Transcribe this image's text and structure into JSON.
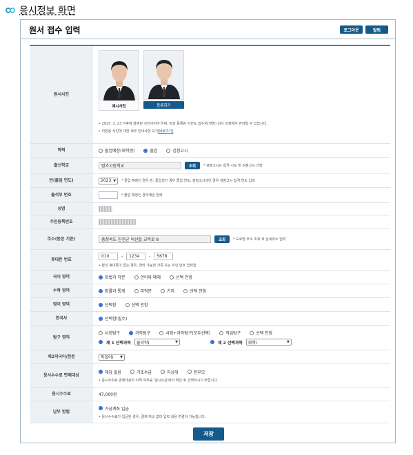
{
  "page_heading": "응시정보 화면",
  "form": {
    "title": "원서 접수 입력",
    "logout_label": "로그아웃",
    "withdraw_label": "탈퇴",
    "save_label": "저장"
  },
  "photo": {
    "label": "원서사진",
    "sample_caption": "예시사진",
    "register_label": "등록하기",
    "note1": "• 2025. 2. 23 이후에 촬영된 사진이어야 하며, 정상 등록된 사진도 접수처(현장) 심사 과정에서 반려될 수 있습니다.",
    "note2_prefix": "• 여권용 사진에 대한 세부 안내사항 보기",
    "note2_link": "[바로가기]"
  },
  "education": {
    "label": "학력",
    "options": [
      "졸업예정(재학생)",
      "졸업",
      "검정고시"
    ],
    "selected_index": 1
  },
  "school": {
    "label": "출신학교",
    "value": "명가고등학교",
    "search_label": "조회",
    "hint": "* 검정고시는 합격 시도 및 검정고시 선택"
  },
  "graduation": {
    "label": "반(졸업 연도)",
    "year": "2023",
    "hint": "* 졸업 예정인 경우 반, 졸업생인 경우 졸업 연도, 검정고시생인 경우 검정고시 합격 연도 입력"
  },
  "attendance": {
    "label": "출석부 번호",
    "value": "",
    "hint": "* 졸업 예정인 경우에만 입력"
  },
  "name": {
    "label": "성명"
  },
  "resident": {
    "label": "주민등록번호"
  },
  "address": {
    "label_line1": "주소",
    "label_line2": "(등본 기준)",
    "value": "충청북도 진천군 덕산읍 교학로 8",
    "search_label": "조회",
    "hint": "* 도로명 주소 조회 후 상세주소 입력"
  },
  "phone": {
    "label": "휴대폰 번호",
    "part1": "010",
    "part2": "1234",
    "part3": "5678",
    "separator": "-",
    "hint": "• 본인 휴대폰이 없는 경우, 연락 가능한 가족 또는 지인 번호 입력함"
  },
  "korean": {
    "label": "국어 영역",
    "options": [
      "화법과 작문",
      "언어와 매체",
      "선택 안함"
    ],
    "selected_index": 0
  },
  "math": {
    "label": "수학 영역",
    "options": [
      "확률과 통계",
      "미적분",
      "기하",
      "선택 안함"
    ],
    "selected_index": 0
  },
  "english": {
    "label": "영어 영역",
    "options": [
      "선택함",
      "선택 안함"
    ],
    "selected_index": 0
  },
  "history": {
    "label": "한국사",
    "options": [
      "선택함(필수)"
    ],
    "selected_index": 0
  },
  "inquiry": {
    "label": "탐구 영역",
    "options": [
      "사회탐구",
      "과학탐구",
      "사회+과학탐구(모두선택)",
      "직업탐구",
      "선택 안함"
    ],
    "selected_index": 1,
    "first_label": "제 1 선택과목",
    "first_value": "물리학Ⅰ",
    "second_label": "제 2 선택과목",
    "second_value": "화학Ⅰ"
  },
  "foreign": {
    "label": "제2외국어/한문",
    "value": "독일어Ⅰ"
  },
  "exemption": {
    "label": "응시수수료 면제대상",
    "options": [
      "해당 없음",
      "기초수급",
      "차상위",
      "한부모"
    ],
    "selected_index": 0,
    "hint": "• 응시수수료 면제대상자 자격 여부를 '실시요강'에서 확인 후 선택하시기 바랍니다."
  },
  "fee": {
    "label": "응시수수료",
    "value": "47,000원"
  },
  "payment": {
    "label": "납부 방법",
    "options": [
      "가상계좌 입금"
    ],
    "selected_index": 0,
    "hint": "• 응시수수료가 입금된 경우, 결제 취소 없이 입력 내용 변경이 가능합니다."
  }
}
